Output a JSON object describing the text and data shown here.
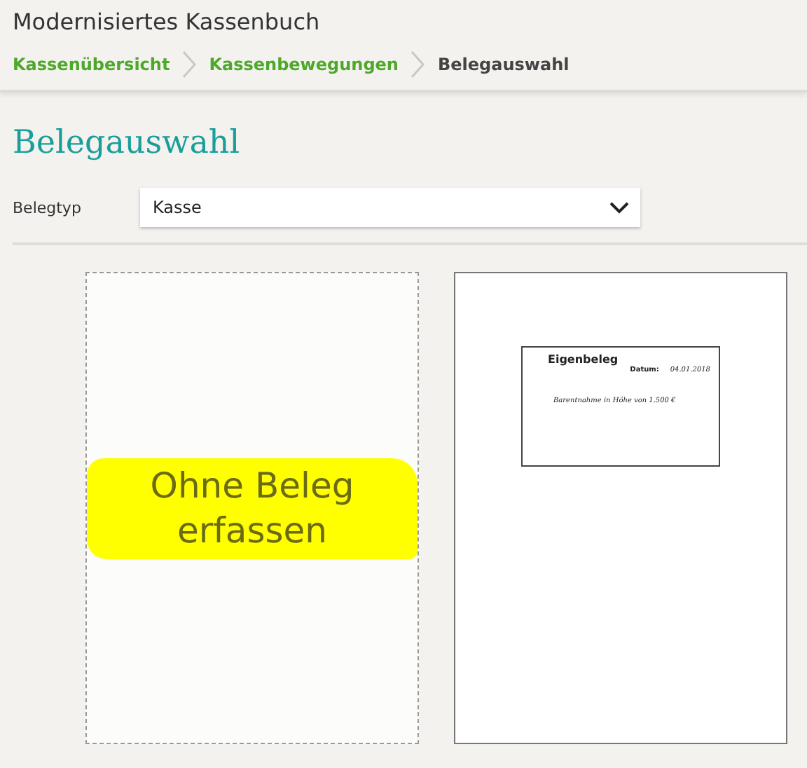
{
  "app_title": "Modernisiertes Kassenbuch",
  "breadcrumb": [
    {
      "label": "Kassenübersicht",
      "selected": false
    },
    {
      "label": "Kassenbewegungen",
      "selected": false
    },
    {
      "label": "Belegauswahl",
      "selected": true
    }
  ],
  "heading": "Belegauswahl",
  "belegtyp": {
    "label": "Belegtyp",
    "value": "Kasse"
  },
  "cards": [
    {
      "kind": "blank",
      "label": "Ohne Beleg erfassen",
      "highlighted": true
    },
    {
      "kind": "document",
      "title": "Eigenbeleg",
      "date_label": "Datum:",
      "date": "04.01.2018",
      "text": "Barentnahme in Höhe von 1.500 €"
    }
  ]
}
